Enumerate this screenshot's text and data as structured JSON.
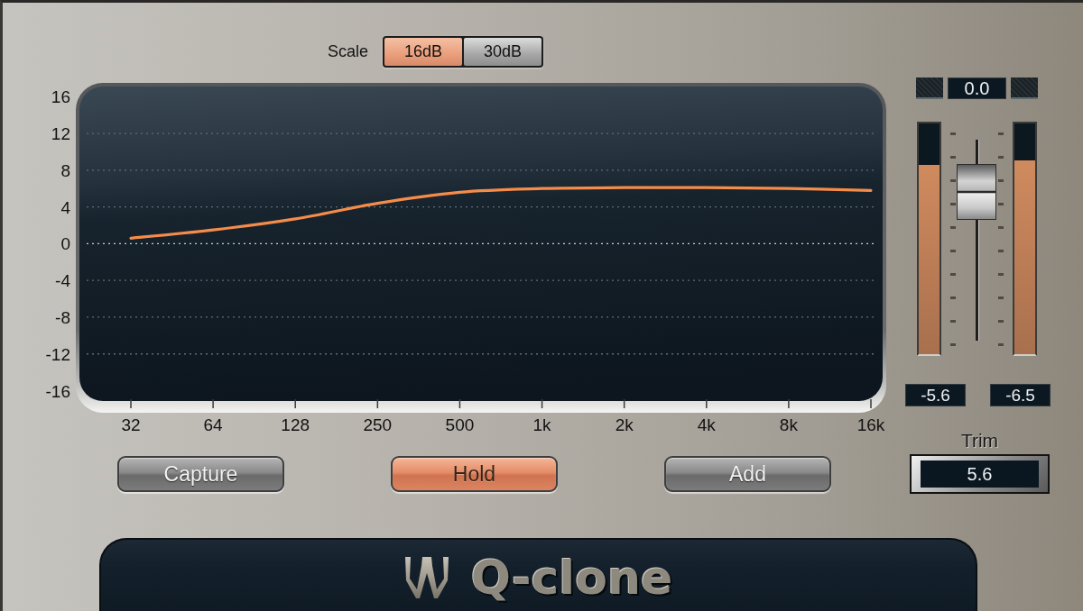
{
  "scale": {
    "label": "Scale",
    "options": [
      {
        "label": "16dB",
        "selected": true
      },
      {
        "label": "30dB",
        "selected": false
      }
    ]
  },
  "graph": {
    "chart_data": {
      "type": "line",
      "categories": [
        "32",
        "64",
        "128",
        "250",
        "500",
        "1k",
        "2k",
        "4k",
        "8k",
        "16k"
      ],
      "series": [
        {
          "color": "#f58c4a",
          "values": [
            0.6,
            1.5,
            2.7,
            4.4,
            5.6,
            6.0,
            6.1,
            6.1,
            6.0,
            5.8
          ]
        }
      ],
      "ylim": [
        -18.4,
        17.5
      ],
      "yticks": [
        16,
        12,
        8,
        4,
        0,
        -4,
        -8,
        -12,
        -16
      ],
      "grid": true,
      "ref_lines": [
        {
          "axis": "y",
          "value": 0
        }
      ]
    }
  },
  "buttons": [
    {
      "label": "Capture",
      "on": false
    },
    {
      "label": "Hold",
      "on": true
    },
    {
      "label": "Add",
      "on": false
    }
  ],
  "meters": [
    {
      "clip": false,
      "level": 0.82,
      "reading": "-5.6"
    },
    {
      "clip": false,
      "level": 0.84,
      "reading": "-6.5"
    }
  ],
  "fader": {
    "reading": "0.0",
    "level": 0.74
  },
  "trim": {
    "label": "Trim",
    "value": "5.6"
  },
  "logo": {
    "text": "Q-clone"
  }
}
